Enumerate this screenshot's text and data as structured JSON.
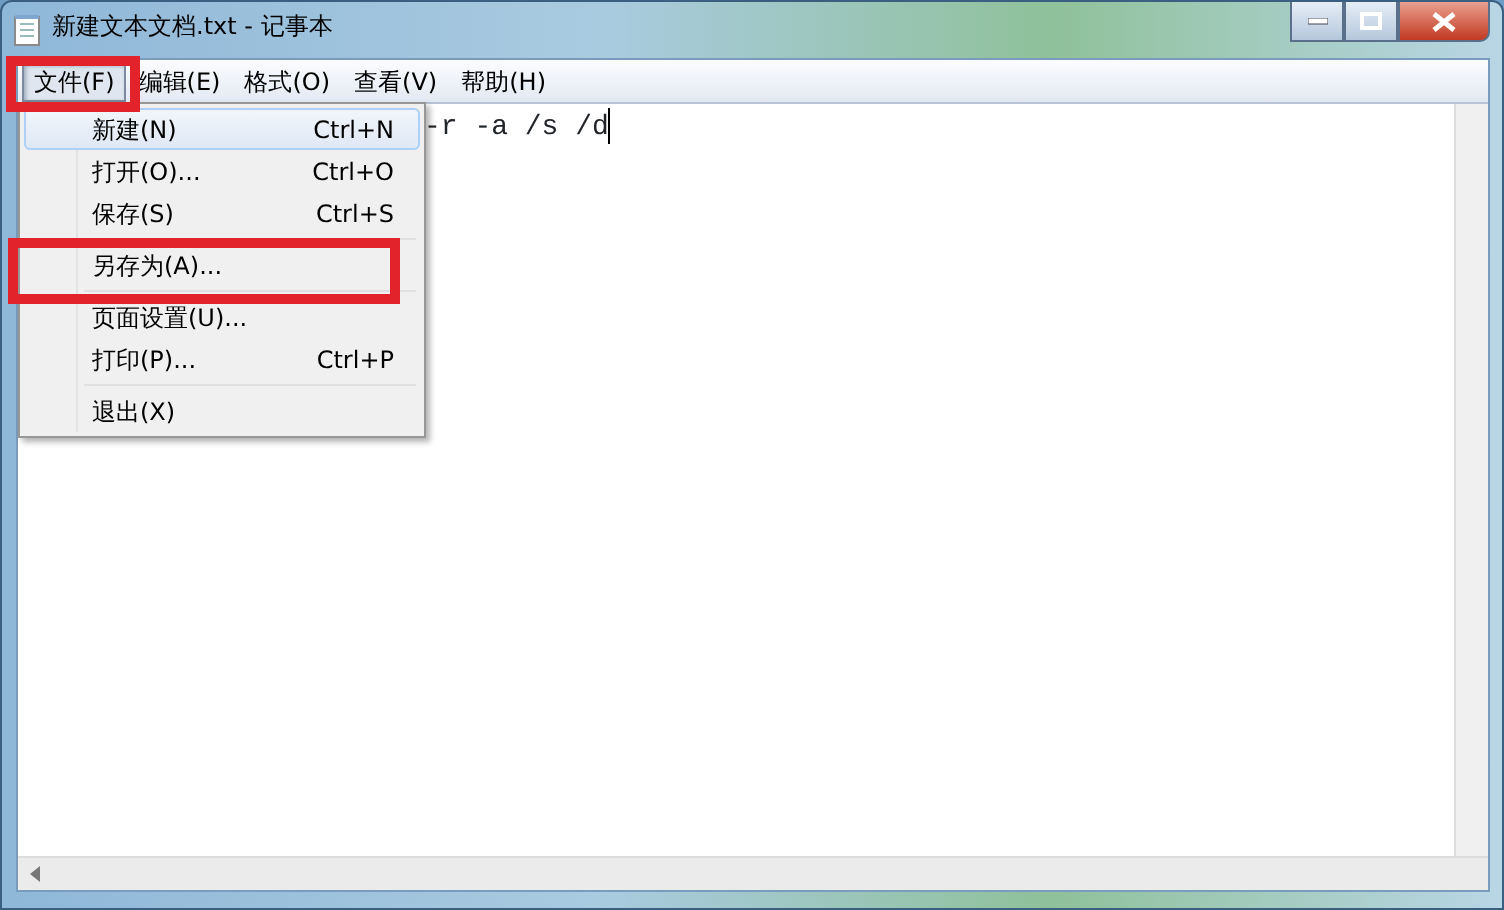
{
  "window": {
    "title": "新建文本文档.txt - 记事本"
  },
  "menu_bar": [
    {
      "label": "文件(F)",
      "selected": true
    },
    {
      "label": "编辑(E)",
      "selected": false
    },
    {
      "label": "格式(O)",
      "selected": false
    },
    {
      "label": "查看(V)",
      "selected": false
    },
    {
      "label": "帮助(H)",
      "selected": false
    }
  ],
  "file_menu": [
    {
      "kind": "item",
      "label": "新建(N)",
      "shortcut": "Ctrl+N",
      "selected": true
    },
    {
      "kind": "item",
      "label": "打开(O)...",
      "shortcut": "Ctrl+O",
      "selected": false
    },
    {
      "kind": "item",
      "label": "保存(S)",
      "shortcut": "Ctrl+S",
      "selected": false
    },
    {
      "kind": "separator"
    },
    {
      "kind": "item",
      "label": "另存为(A)...",
      "selected": false
    },
    {
      "kind": "separator"
    },
    {
      "kind": "item",
      "label": "页面设置(U)...",
      "selected": false
    },
    {
      "kind": "item",
      "label": "打印(P)...",
      "shortcut": "Ctrl+P",
      "selected": false
    },
    {
      "kind": "separator"
    },
    {
      "kind": "item",
      "label": "退出(X)",
      "selected": false
    }
  ],
  "editor": {
    "text": "-r -a /s /d"
  },
  "highlights": [
    {
      "kind": "frame"
    },
    {
      "kind": "frame"
    }
  ]
}
